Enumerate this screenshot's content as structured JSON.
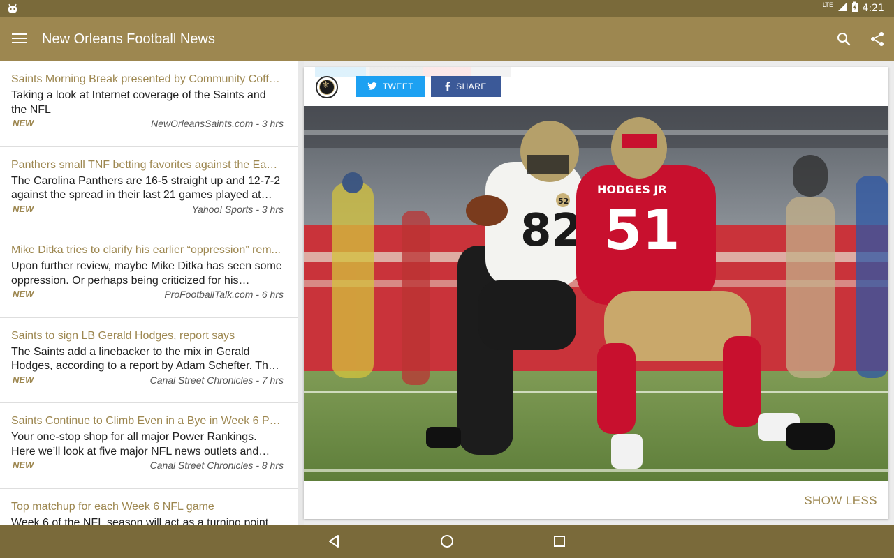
{
  "status_bar": {
    "time": "4:21",
    "network": "LTE",
    "icons": [
      "android-icon",
      "signal-icon",
      "battery-icon"
    ]
  },
  "app_bar": {
    "title": "New Orleans Football News",
    "icons": [
      "menu-icon",
      "search-icon",
      "share-icon"
    ]
  },
  "news": [
    {
      "title": "Saints Morning Break presented by Community Coffe...",
      "summary": "Taking a look at Internet coverage of the Saints and the NFL",
      "badge": "NEW",
      "source": "NewOrleansSaints.com - 3 hrs"
    },
    {
      "title": "Panthers small TNF betting favorites against the Eagl...",
      "summary": "The Carolina Panthers are 16-5 straight up and 12-7-2 against the spread in their last 21 games played at ho...",
      "badge": "NEW",
      "source": "Yahoo! Sports - 3 hrs"
    },
    {
      "title": "Mike Ditka tries to clarify his earlier “oppression” rem...",
      "summary": "Upon further review, maybe Mike Ditka has seen some oppression. Or perhaps being criticized for his remark...",
      "badge": "NEW",
      "source": "ProFootballTalk.com - 6 hrs"
    },
    {
      "title": "Saints to sign LB Gerald Hodges, report says",
      "summary": "The Saints add a linebacker to the mix in Gerald Hodges, according to a report by Adam Schefter. The ...",
      "badge": "NEW",
      "source": "Canal Street Chronicles - 7 hrs"
    },
    {
      "title": "Saints Continue to Climb Even in a Bye in Week 6 Po...",
      "summary": "Your one-stop shop for all major Power Rankings. Here we’ll look at five major NFL news outlets and thei...",
      "badge": "NEW",
      "source": "Canal Street Chronicles - 8 hrs"
    },
    {
      "title": "Top matchup for each Week 6 NFL game",
      "summary": "Week 6 of the NFL season will act as a turning point",
      "badge": "",
      "source": ""
    }
  ],
  "article_card": {
    "tweet_label": "TWEET",
    "share_label": "SHARE",
    "show_less_label": "SHOW LESS",
    "photo_jersey_numbers": [
      "82",
      "51"
    ],
    "photo_name_plate": "HODGES JR",
    "photo_patch": "52"
  },
  "colors": {
    "primary": "#9d8750",
    "primary_dark": "#7a6a3a",
    "twitter": "#1da1f2",
    "facebook": "#3b5998"
  },
  "nav_bar": {
    "icons": [
      "back-icon",
      "home-icon",
      "recents-icon"
    ]
  }
}
